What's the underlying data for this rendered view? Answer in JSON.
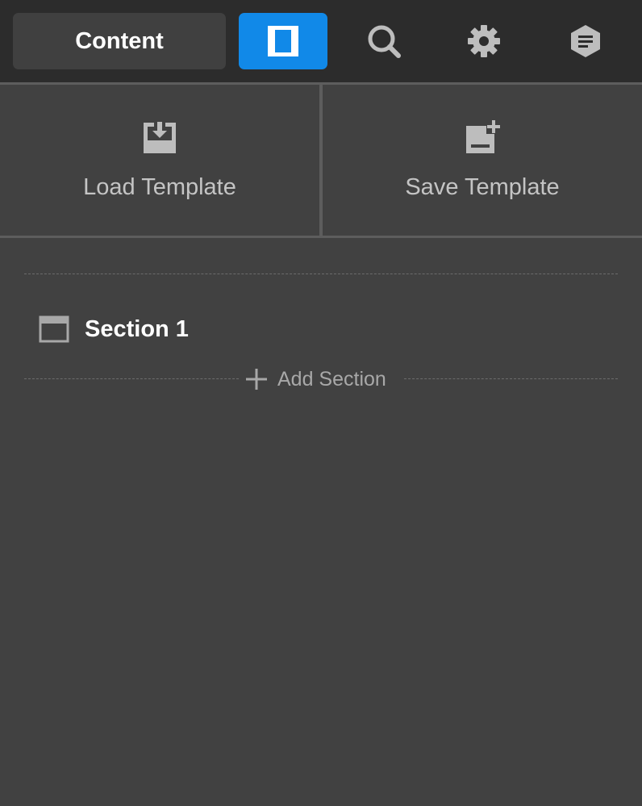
{
  "toolbar": {
    "content_label": "Content",
    "layout_icon": "panel-layout-icon",
    "search_icon": "search-icon",
    "settings_icon": "gear-icon",
    "notes_icon": "document-lines-icon",
    "active_color": "#1189e8"
  },
  "templates": {
    "load_label": "Load Template",
    "load_icon": "inbox-download-icon",
    "save_label": "Save Template",
    "save_icon": "document-add-icon"
  },
  "sections": {
    "items": [
      {
        "label": "Section 1",
        "icon": "section-window-icon"
      }
    ],
    "add_label": "Add Section",
    "add_icon": "plus-icon"
  }
}
